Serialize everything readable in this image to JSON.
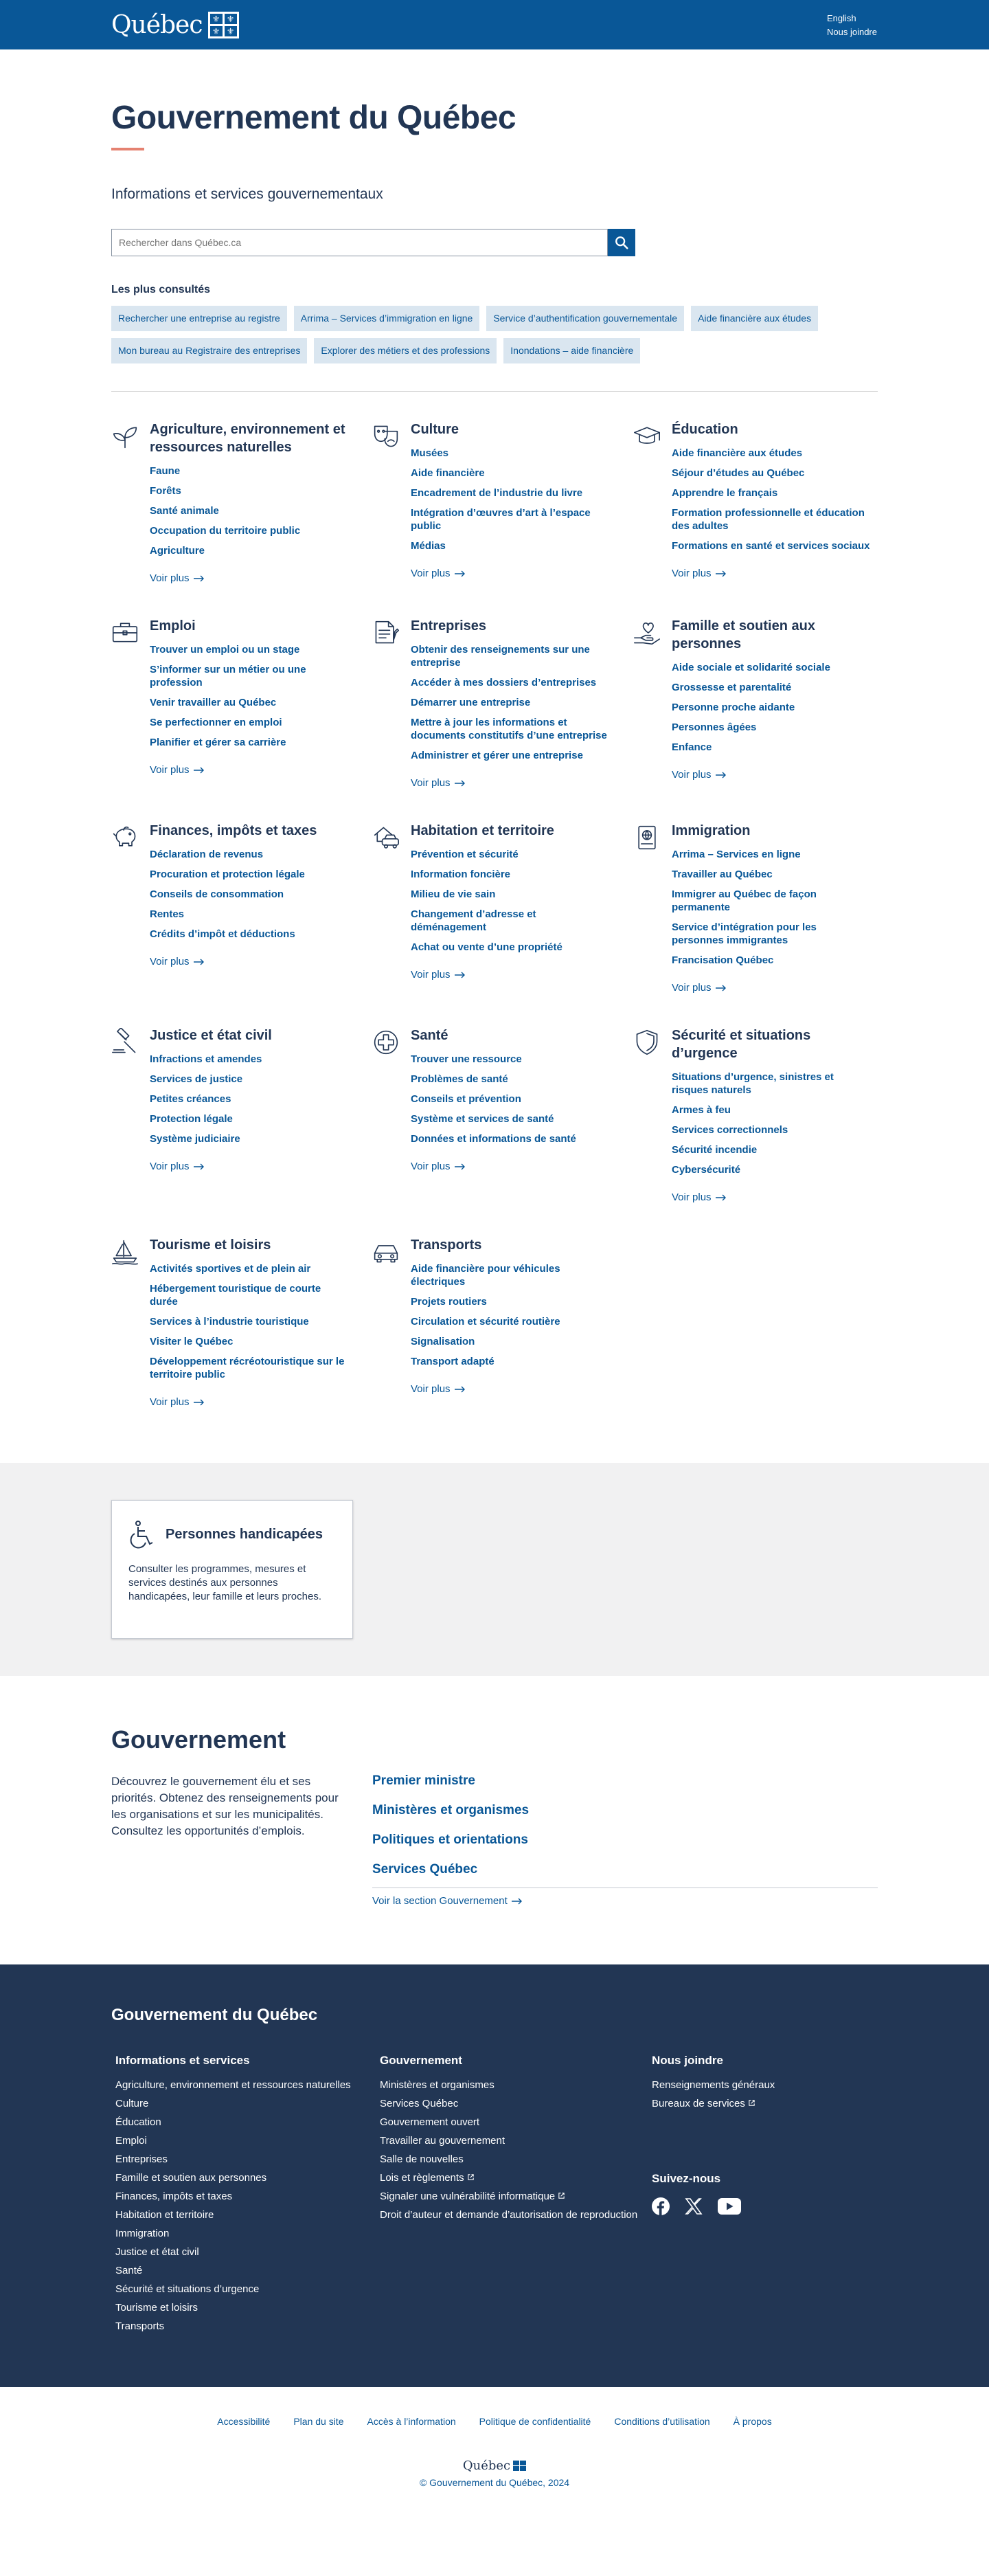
{
  "header": {
    "logo_text": "Québec",
    "lang_link": "English",
    "contact_link": "Nous joindre"
  },
  "hero": {
    "title": "Gouvernement du Québec",
    "subtitle": "Informations et services gouvernementaux",
    "search_placeholder": "Rechercher dans Québec.ca"
  },
  "popular": {
    "title": "Les plus consultés",
    "chips": [
      "Rechercher une entreprise au registre",
      "Arrima – Services d’immigration en ligne",
      "Service d’authentification gouvernementale",
      "Aide financière aux études",
      "Mon bureau au Registraire des entreprises",
      "Explorer des métiers et des professions",
      "Inondations – aide financière"
    ]
  },
  "voir_plus": "Voir plus",
  "categories": [
    {
      "title": "Agriculture, environnement et ressources naturelles",
      "icon": "plant-icon",
      "links": [
        "Faune",
        "Forêts",
        "Santé animale",
        "Occupation du territoire public",
        "Agriculture"
      ]
    },
    {
      "title": "Culture",
      "icon": "theatre-masks-icon",
      "links": [
        "Musées",
        "Aide financière",
        "Encadrement de l’industrie du livre",
        "Intégration d’œuvres d’art à l’espace public",
        "Médias"
      ]
    },
    {
      "title": "Éducation",
      "icon": "graduation-cap-icon",
      "links": [
        "Aide financière aux études",
        "Séjour d’études au Québec",
        "Apprendre le français",
        "Formation professionnelle et éducation des adultes",
        "Formations en santé et services sociaux"
      ]
    },
    {
      "title": "Emploi",
      "icon": "briefcase-icon",
      "links": [
        "Trouver un emploi ou un stage",
        "S’informer sur un métier ou une profession",
        "Venir travailler au Québec",
        "Se perfectionner en emploi",
        "Planifier et gérer sa carrière"
      ]
    },
    {
      "title": "Entreprises",
      "icon": "documents-icon",
      "links": [
        "Obtenir des renseignements sur une entreprise",
        "Accéder à mes dossiers d’entreprises",
        "Démarrer une entreprise",
        "Mettre à jour les informations et documents constitutifs d’une entreprise",
        "Administrer et gérer une entreprise"
      ]
    },
    {
      "title": "Famille et soutien aux personnes",
      "icon": "heart-hand-icon",
      "links": [
        "Aide sociale et solidarité sociale",
        "Grossesse et parentalité",
        "Personne proche aidante",
        "Personnes âgées",
        "Enfance"
      ]
    },
    {
      "title": "Finances, impôts et taxes",
      "icon": "piggy-bank-icon",
      "links": [
        "Déclaration de revenus",
        "Procuration et protection légale",
        "Conseils de consommation",
        "Rentes",
        "Crédits d’impôt et déductions"
      ]
    },
    {
      "title": "Habitation et territoire",
      "icon": "house-car-icon",
      "links": [
        "Prévention et sécurité",
        "Information foncière",
        "Milieu de vie sain",
        "Changement d’adresse et déménagement",
        "Achat ou vente d’une propriété"
      ]
    },
    {
      "title": "Immigration",
      "icon": "passport-icon",
      "links": [
        "Arrima – Services en ligne",
        "Travailler au Québec",
        "Immigrer au Québec de façon permanente",
        "Service d’intégration pour les personnes immigrantes",
        "Francisation Québec"
      ]
    },
    {
      "title": "Justice et état civil",
      "icon": "gavel-icon",
      "links": [
        "Infractions et amendes",
        "Services de justice",
        "Petites créances",
        "Protection légale",
        "Système judiciaire"
      ]
    },
    {
      "title": "Santé",
      "icon": "health-cross-icon",
      "links": [
        "Trouver une ressource",
        "Problèmes de santé",
        "Conseils et prévention",
        "Système et services de santé",
        "Données et informations de santé"
      ]
    },
    {
      "title": "Sécurité et situations d’urgence",
      "icon": "shield-icon",
      "links": [
        "Situations d’urgence, sinistres et risques naturels",
        "Armes à feu",
        "Services correctionnels",
        "Sécurité incendie",
        "Cybersécurité"
      ]
    },
    {
      "title": "Tourisme et loisirs",
      "icon": "sailboat-icon",
      "links": [
        "Activités sportives et de plein air",
        "Hébergement touristique de courte durée",
        "Services à l’industrie touristique",
        "Visiter le Québec",
        "Développement récréotouristique sur le territoire public"
      ]
    },
    {
      "title": "Transports",
      "icon": "car-icon",
      "links": [
        "Aide financière pour véhicules électriques",
        "Projets routiers",
        "Circulation et sécurité routière",
        "Signalisation",
        "Transport adapté"
      ]
    }
  ],
  "handicap": {
    "title": "Personnes handicapées",
    "text": "Consulter les programmes, mesures et services destinés aux personnes handicapées, leur famille et leurs proches."
  },
  "gouvernement": {
    "title": "Gouvernement",
    "text": "Découvrez le gouvernement élu et ses priorités. Obtenez des renseignements pour les organisations et sur les municipalités. Consultez les opportunités d’emplois.",
    "links": [
      "Premier ministre",
      "Ministères et organismes",
      "Politiques et orientations",
      "Services Québec"
    ],
    "more": "Voir la section Gouvernement"
  },
  "footer": {
    "title": "Gouvernement du Québec",
    "col1_title": "Informations et services",
    "col1": [
      "Agriculture, environnement et ressources naturelles",
      "Culture",
      "Éducation",
      "Emploi",
      "Entreprises",
      "Famille et soutien aux personnes",
      "Finances, impôts et taxes",
      "Habitation et territoire",
      "Immigration",
      "Justice et état civil",
      "Santé",
      "Sécurité et situations d’urgence",
      "Tourisme et loisirs",
      "Transports"
    ],
    "col2_title": "Gouvernement",
    "col2": [
      "Ministères et organismes",
      "Services Québec",
      "Gouvernement ouvert",
      "Travailler au gouvernement",
      "Salle de nouvelles",
      "Lois et règlements",
      "Signaler une vulnérabilité informatique",
      "Droit d’auteur et demande d’autorisation de reproduction"
    ],
    "col3_title": "Nous joindre",
    "col3": [
      "Renseignements généraux",
      "Bureaux de services"
    ],
    "follow_title": "Suivez-nous"
  },
  "bottom": {
    "links": [
      "Accessibilité",
      "Plan du site",
      "Accès à l’information",
      "Politique de confidentialité",
      "Conditions d’utilisation",
      "À propos"
    ],
    "logo_text": "Québec",
    "copyright": "© Gouvernement du Québec, 2024"
  }
}
